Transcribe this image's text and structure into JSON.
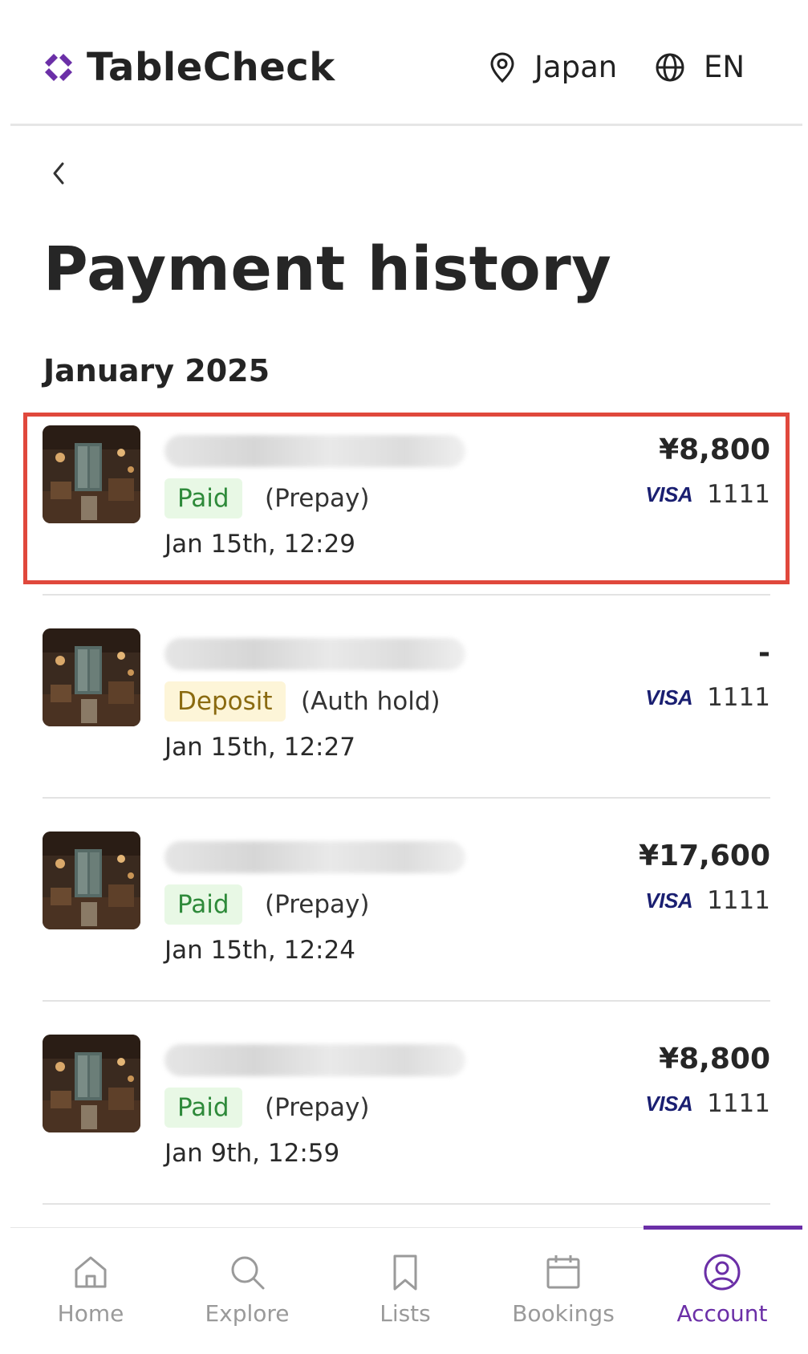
{
  "header": {
    "brand": "TableCheck",
    "region": "Japan",
    "language": "EN"
  },
  "page": {
    "title": "Payment history",
    "month": "January 2025"
  },
  "payments": [
    {
      "status": "Paid",
      "type": "(Prepay)",
      "date": "Jan 15th, 12:29",
      "amount": "¥8,800",
      "card_brand": "VISA",
      "card_last4": "1111"
    },
    {
      "status": "Deposit",
      "type": "(Auth hold)",
      "date": "Jan 15th, 12:27",
      "amount": "-",
      "card_brand": "VISA",
      "card_last4": "1111"
    },
    {
      "status": "Paid",
      "type": "(Prepay)",
      "date": "Jan 15th, 12:24",
      "amount": "¥17,600",
      "card_brand": "VISA",
      "card_last4": "1111"
    },
    {
      "status": "Paid",
      "type": "(Prepay)",
      "date": "Jan 9th, 12:59",
      "amount": "¥8,800",
      "card_brand": "VISA",
      "card_last4": "1111"
    }
  ],
  "nav": [
    {
      "label": "Home",
      "icon": "home-icon"
    },
    {
      "label": "Explore",
      "icon": "search-icon"
    },
    {
      "label": "Lists",
      "icon": "bookmark-icon"
    },
    {
      "label": "Bookings",
      "icon": "calendar-icon"
    },
    {
      "label": "Account",
      "icon": "account-icon",
      "active": true
    }
  ],
  "colors": {
    "brand_accent": "#6b2fa7",
    "paid_bg": "#e8f8e5",
    "paid_text": "#2e8a3a",
    "deposit_bg": "#fdf5d8",
    "deposit_text": "#8a6a10",
    "highlight": "#e0483c",
    "visa": "#1a1f71"
  }
}
